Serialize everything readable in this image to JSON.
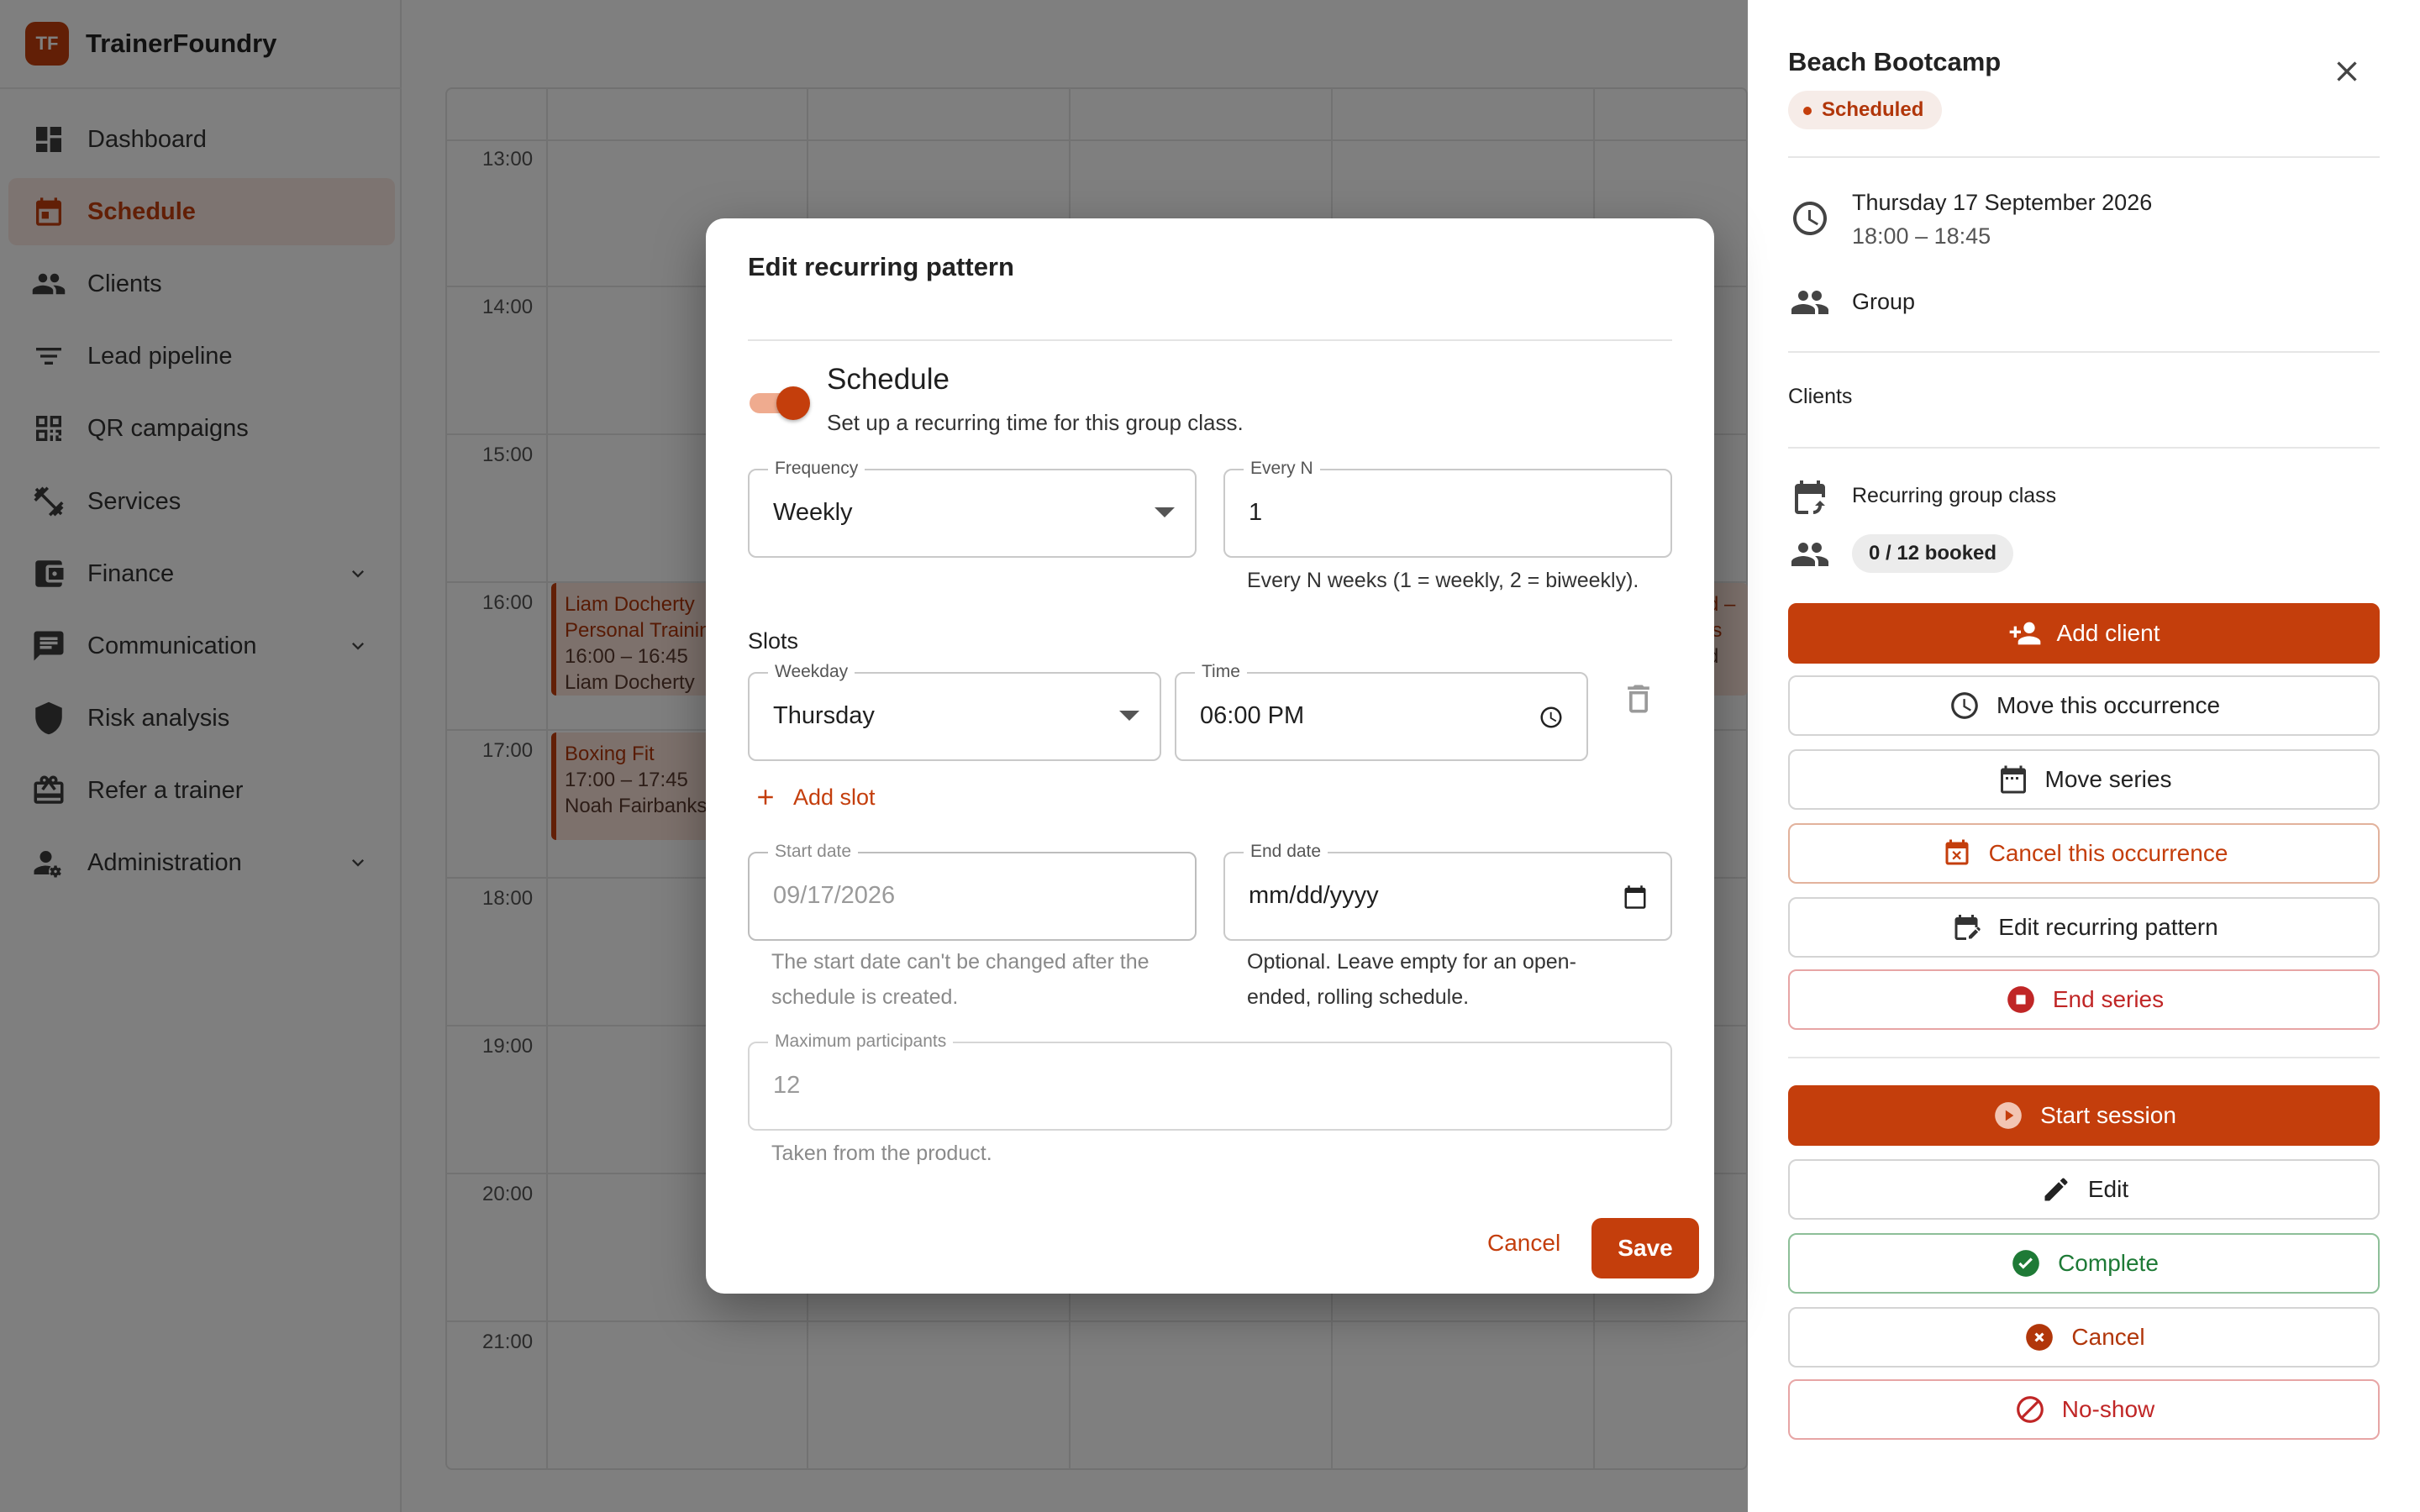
{
  "app": {
    "logo_text": "TF",
    "name": "TrainerFoundry"
  },
  "sidebar": {
    "items": [
      {
        "label": "Dashboard",
        "icon": "dashboard-icon"
      },
      {
        "label": "Schedule",
        "icon": "calendar-icon",
        "active": true
      },
      {
        "label": "Clients",
        "icon": "people-icon"
      },
      {
        "label": "Lead pipeline",
        "icon": "filter-icon"
      },
      {
        "label": "QR campaigns",
        "icon": "qr-code-icon"
      },
      {
        "label": "Services",
        "icon": "fitness-icon"
      },
      {
        "label": "Finance",
        "icon": "wallet-icon",
        "expandable": true
      },
      {
        "label": "Communication",
        "icon": "chat-icon",
        "expandable": true
      },
      {
        "label": "Risk analysis",
        "icon": "shield-icon"
      },
      {
        "label": "Refer a trainer",
        "icon": "gift-icon"
      },
      {
        "label": "Administration",
        "icon": "admin-icon",
        "expandable": true
      }
    ]
  },
  "calendar": {
    "hours": [
      "13:00",
      "14:00",
      "15:00",
      "16:00",
      "17:00",
      "18:00",
      "19:00",
      "20:00",
      "21:00"
    ],
    "events": [
      {
        "line1": "Liam Docherty",
        "line2": "Personal Training",
        "line3": "16:00 – 16:45",
        "line4": "Liam Docherty"
      },
      {
        "line1": "Boxing Fit",
        "line2": "17:00 – 17:45",
        "line3": "Noah Fairbanks"
      },
      {
        "line1": "rd –",
        "line2": "ns",
        "line3": "rd"
      }
    ]
  },
  "panel": {
    "title": "Beach Bootcamp",
    "status": "Scheduled",
    "date": "Thursday 17 September 2026",
    "time": "18:00 – 18:45",
    "type": "Group",
    "clients_label": "Clients",
    "recurring_label": "Recurring group class",
    "booked": "0 / 12 booked",
    "buttons": {
      "add_client": "Add client",
      "move_occurrence": "Move this occurrence",
      "move_series": "Move series",
      "cancel_occurrence": "Cancel this occurrence",
      "edit_pattern": "Edit recurring pattern",
      "end_series": "End series",
      "start_session": "Start session",
      "edit": "Edit",
      "complete": "Complete",
      "cancel": "Cancel",
      "no_show": "No-show"
    }
  },
  "dialog": {
    "title": "Edit recurring pattern",
    "schedule_title": "Schedule",
    "schedule_sub": "Set up a recurring time for this group class.",
    "frequency_label": "Frequency",
    "frequency_value": "Weekly",
    "every_n_label": "Every N",
    "every_n_value": "1",
    "every_n_help": "Every N weeks (1 = weekly, 2 = biweekly).",
    "slots_title": "Slots",
    "weekday_label": "Weekday",
    "weekday_value": "Thursday",
    "time_label": "Time",
    "time_value": "06:00 PM",
    "add_slot": "Add slot",
    "start_date_label": "Start date",
    "start_date_value": "09/17/2026",
    "start_date_help_1": "The start date can't be changed after the",
    "start_date_help_2": "schedule is created.",
    "end_date_label": "End date",
    "end_date_value": "mm/dd/yyyy",
    "end_date_help_1": "Optional. Leave empty for an open-",
    "end_date_help_2": "ended, rolling schedule.",
    "max_label": "Maximum participants",
    "max_value": "12",
    "max_help": "Taken from the product.",
    "cancel": "Cancel",
    "save": "Save"
  },
  "colors": {
    "accent": "#c43e0c",
    "success": "#1e7a36",
    "danger": "#c02626"
  }
}
